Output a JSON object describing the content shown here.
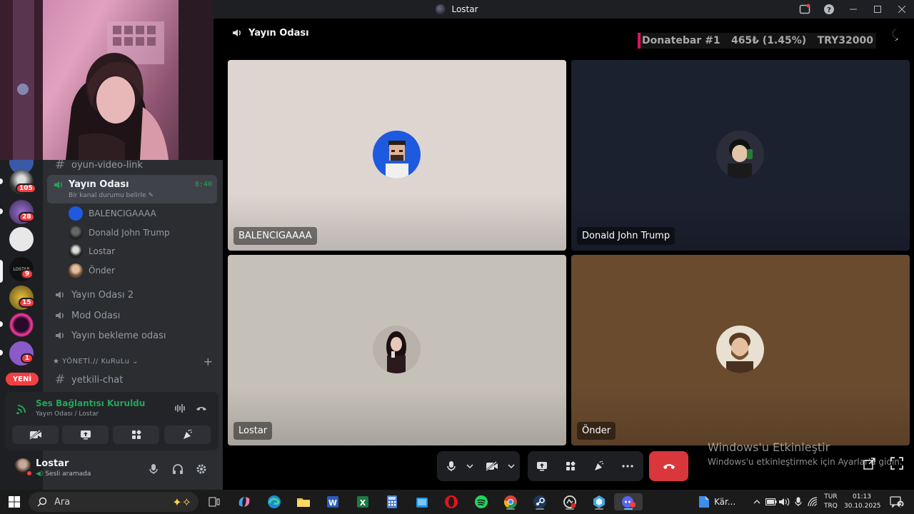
{
  "window": {
    "title": "Lostar"
  },
  "servers": [
    {
      "badge": "105"
    },
    {
      "badge": "28"
    },
    {
      "badge": ""
    },
    {
      "badge": "9",
      "label": "LOSTAR"
    },
    {
      "badge": "15"
    },
    {
      "badge": ""
    },
    {
      "badge": "1"
    }
  ],
  "servers_new_label": "YENİ",
  "channels": {
    "text_top": "oyun-video-link",
    "active": {
      "name": "Yayın Odası",
      "status": "Bir kanal durumu belirle",
      "timer": "8:40"
    },
    "voice_users": [
      "BALENCIGAAAA",
      "Donald John Trump",
      "Lostar",
      "Önder"
    ],
    "voice_other": [
      "Yayın Odası 2",
      "Mod Odası",
      "Yayın bekleme odası"
    ],
    "category": "★ YÖNETİ.// KuRuLu",
    "text_bottom": "yetkili-chat"
  },
  "voice_panel": {
    "title": "Ses Bağlantısı Kuruldu",
    "subtitle": "Yayın Odası / Lostar"
  },
  "user_panel": {
    "name": "Lostar",
    "status": "Sesli aramada"
  },
  "stage": {
    "channel": "Yayın Odası",
    "donate": {
      "label": "Donatebar #1",
      "amount": "465₺ (1.45%)",
      "goal": "TRY32000",
      "progress_percent": 1.45
    },
    "tiles": [
      {
        "name": "BALENCIGAAAA",
        "bg": "#ded5d0"
      },
      {
        "name": "Donald John Trump",
        "bg": "#1c2130"
      },
      {
        "name": "Lostar",
        "bg": "#c5c0b8"
      },
      {
        "name": "Önder",
        "bg": "#6a4b2e"
      }
    ]
  },
  "watermark": {
    "line1": "Windows'u Etkinleştir",
    "line2": "Windows'u etkinleştirmek için Ayarlar'a gidin."
  },
  "taskbar": {
    "search_placeholder": "Ara",
    "pinned_label": "Kär...",
    "lang1": "TUR",
    "lang2": "TRQ",
    "time": "01:13",
    "date": "30.10.2025",
    "notif_count": "2"
  }
}
